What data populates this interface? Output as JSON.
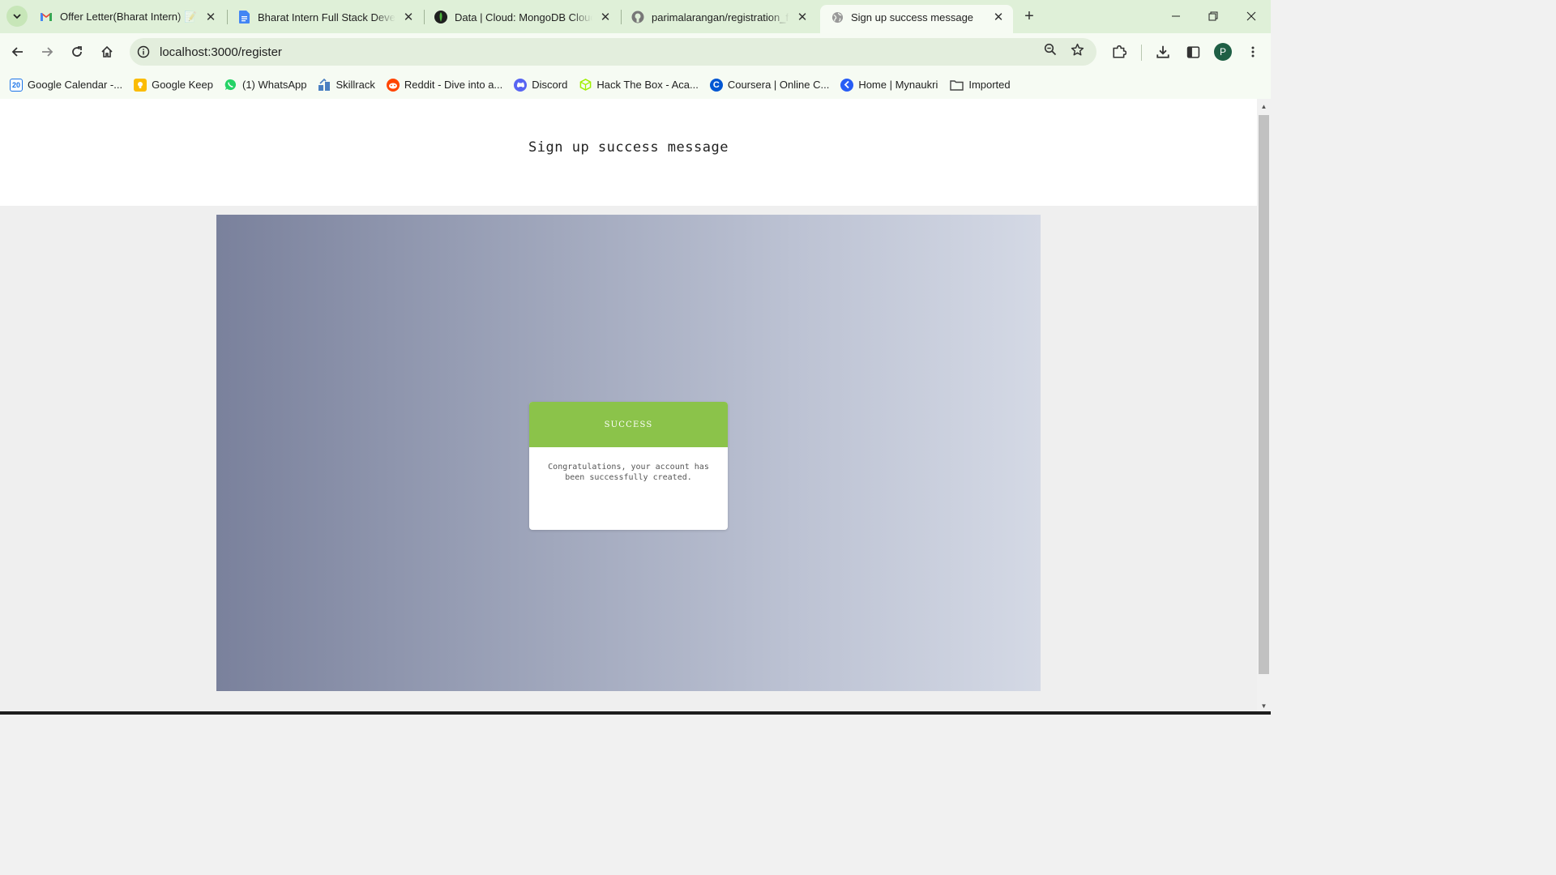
{
  "browser": {
    "tabs": [
      {
        "title": "Offer Letter(Bharat Intern) 📝 - g",
        "favicon": "gmail-icon"
      },
      {
        "title": "Bharat Intern Full Stack Develop",
        "favicon": "google-docs-icon"
      },
      {
        "title": "Data | Cloud: MongoDB Cloud",
        "favicon": "mongodb-icon"
      },
      {
        "title": "parimalarangan/registration_for",
        "favicon": "github-icon"
      },
      {
        "title": "Sign up success message",
        "favicon": "globe-icon",
        "active": true
      }
    ],
    "new_tab_label": "+",
    "url": "localhost:3000/register",
    "profile_initial": "P",
    "bookmarks": [
      {
        "label": "Google Calendar -...",
        "icon": "calendar-icon",
        "color": "#1a73e8",
        "glyph": "20"
      },
      {
        "label": "Google Keep",
        "icon": "keep-icon",
        "color": "#fbbc04",
        "glyph": ""
      },
      {
        "label": "(1) WhatsApp",
        "icon": "whatsapp-icon",
        "color": "#25d366",
        "glyph": ""
      },
      {
        "label": "Skillrack",
        "icon": "skillrack-icon",
        "color": "#4a7fc1",
        "glyph": ""
      },
      {
        "label": "Reddit - Dive into a...",
        "icon": "reddit-icon",
        "color": "#ff4500",
        "glyph": ""
      },
      {
        "label": "Discord",
        "icon": "discord-icon",
        "color": "#5865f2",
        "glyph": ""
      },
      {
        "label": "Hack The Box - Aca...",
        "icon": "hackthebox-icon",
        "color": "#9fef00",
        "glyph": ""
      },
      {
        "label": "Coursera | Online C...",
        "icon": "coursera-icon",
        "color": "#0056d2",
        "glyph": "C"
      },
      {
        "label": "Home | Mynaukri",
        "icon": "mynaukri-icon",
        "color": "#275df5",
        "glyph": ""
      },
      {
        "label": "Imported",
        "icon": "folder-icon",
        "color": "#444444",
        "glyph": ""
      }
    ]
  },
  "page": {
    "heading": "Sign up success message",
    "card": {
      "title": "SUCCESS",
      "message": "Congratulations, your account has been successfully created."
    },
    "colors": {
      "success_green": "#8bc34a",
      "gradient_start": "#7a819c",
      "gradient_end": "#d4d9e5"
    }
  }
}
